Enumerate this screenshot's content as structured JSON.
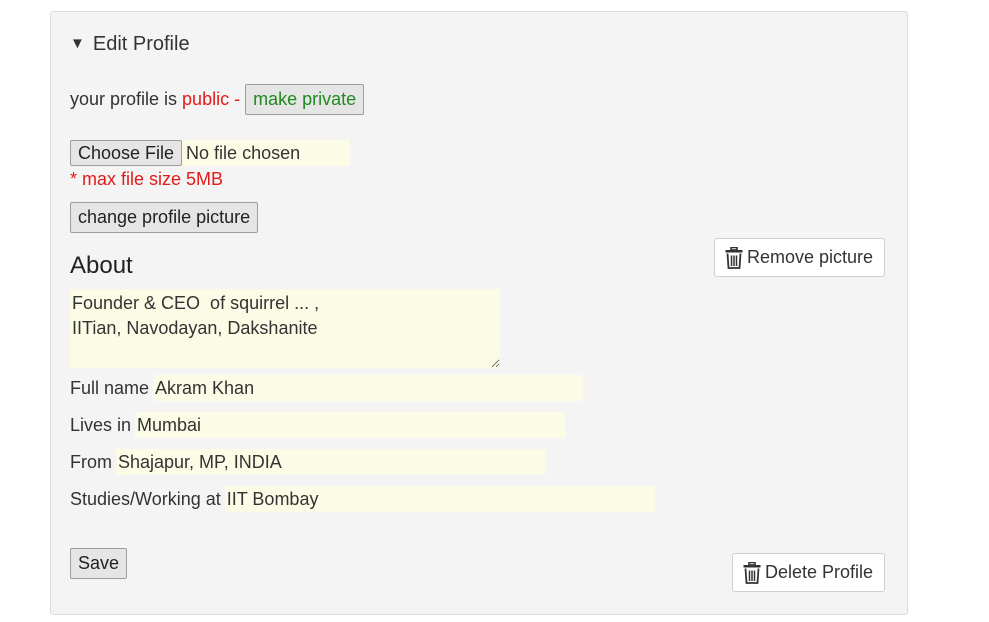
{
  "section": {
    "toggle_icon": "triangle-down-icon",
    "toggle_glyph": "▼",
    "title": "Edit Profile"
  },
  "privacy": {
    "prefix": "your profile is ",
    "status": "public -",
    "button": "make private",
    "colors": {
      "status": "#e21b1b",
      "button": "#1f8a1f"
    }
  },
  "upload": {
    "choose_button": "Choose File",
    "file_status": "No file chosen",
    "max_size_note": "* max file size 5MB",
    "change_button": "change profile picture"
  },
  "remove_picture": {
    "icon": "trash-icon",
    "label": "Remove picture"
  },
  "about": {
    "heading": "About",
    "value": "Founder & CEO  of squirrel ... ,\nIITian, Navodayan, Dakshanite"
  },
  "fields": {
    "full_name": {
      "label": "Full name",
      "value": "Akram Khan"
    },
    "lives_in": {
      "label": "Lives in",
      "value": "Mumbai"
    },
    "from": {
      "label": "From",
      "value": "Shajapur, MP, INDIA"
    },
    "studies": {
      "label": "Studies/Working at",
      "value": "IIT Bombay"
    }
  },
  "actions": {
    "save": "Save",
    "delete": {
      "icon": "trash-icon",
      "label": "Delete Profile"
    }
  },
  "theme": {
    "input_background": "#fcfce6",
    "panel_background": "#f4f4f4"
  }
}
